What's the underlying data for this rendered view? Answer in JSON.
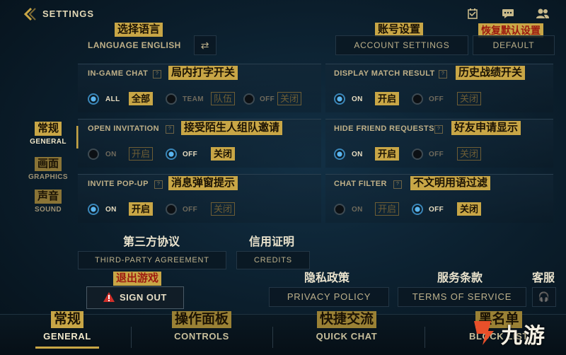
{
  "header": {
    "title": "SETTINGS",
    "back_icon": "chevron-left-icon",
    "icons": [
      "calendar-check-icon",
      "chat-bubble-icon",
      "friends-icon"
    ]
  },
  "top": {
    "language_cn": "选择语言",
    "language_label": "LANGUAGE ENGLISH",
    "account_cn": "账号设置",
    "account_label": "ACCOUNT SETTINGS",
    "default_cn": "恢复默认设置",
    "default_label": "DEFAULT"
  },
  "sidebar": {
    "items": [
      {
        "cn": "常规",
        "en": "GENERAL"
      },
      {
        "cn": "画面",
        "en": "GRAPHICS"
      },
      {
        "cn": "声音",
        "en": "SOUND"
      }
    ]
  },
  "settings": {
    "in_game_chat": {
      "label": "IN-GAME CHAT",
      "cn": "局内打字开关",
      "all": "ALL",
      "all_cn": "全部",
      "team": "TEAM",
      "team_cn": "队伍",
      "off": "OFF",
      "off_cn": "关闭",
      "selected": "ALL"
    },
    "display_match_result": {
      "label": "DISPLAY MATCH RESULT",
      "cn": "历史战绩开关",
      "on": "ON",
      "on_cn": "开启",
      "off": "OFF",
      "off_cn": "关闭",
      "selected": "ON"
    },
    "open_invitation": {
      "label": "OPEN INVITATION",
      "cn": "接受陌生人组队邀请",
      "on": "ON",
      "on_cn": "开启",
      "off": "OFF",
      "off_cn": "关闭",
      "selected": "OFF"
    },
    "hide_friend_requests": {
      "label": "HIDE FRIEND REQUESTS",
      "cn": "好友申请显示",
      "on": "ON",
      "on_cn": "开启",
      "off": "OFF",
      "off_cn": "关闭",
      "selected": "ON"
    },
    "invite_popup": {
      "label": "INVITE POP-UP",
      "cn": "消息弹窗提示",
      "on": "ON",
      "on_cn": "开启",
      "off": "OFF",
      "off_cn": "关闭",
      "selected": "ON"
    },
    "chat_filter": {
      "label": "CHAT FILTER",
      "cn": "不文明用语过滤",
      "on": "ON",
      "on_cn": "开启",
      "off": "OFF",
      "off_cn": "关闭",
      "selected": "OFF"
    }
  },
  "links": {
    "third_party_cn": "第三方协议",
    "third_party": "THIRD-PARTY AGREEMENT",
    "credits_cn": "信用证明",
    "credits": "CREDITS",
    "sign_out_cn": "退出游戏",
    "sign_out": "SIGN OUT",
    "privacy_cn": "隐私政策",
    "privacy": "PRIVACY POLICY",
    "terms_cn": "服务条款",
    "terms": "TERMS OF SERVICE",
    "support_cn": "客服"
  },
  "bottom_tabs": [
    {
      "cn": "常规",
      "en": "GENERAL"
    },
    {
      "cn": "操作面板",
      "en": "CONTROLS"
    },
    {
      "cn": "快捷交流",
      "en": "QUICK CHAT"
    },
    {
      "cn": "黑名单",
      "en": "BLOCK LIST"
    }
  ],
  "watermark": "九游",
  "colors": {
    "accent_gold": "#c8a646",
    "radio_blue": "#5bb6f0",
    "danger_red": "#d0302a"
  }
}
